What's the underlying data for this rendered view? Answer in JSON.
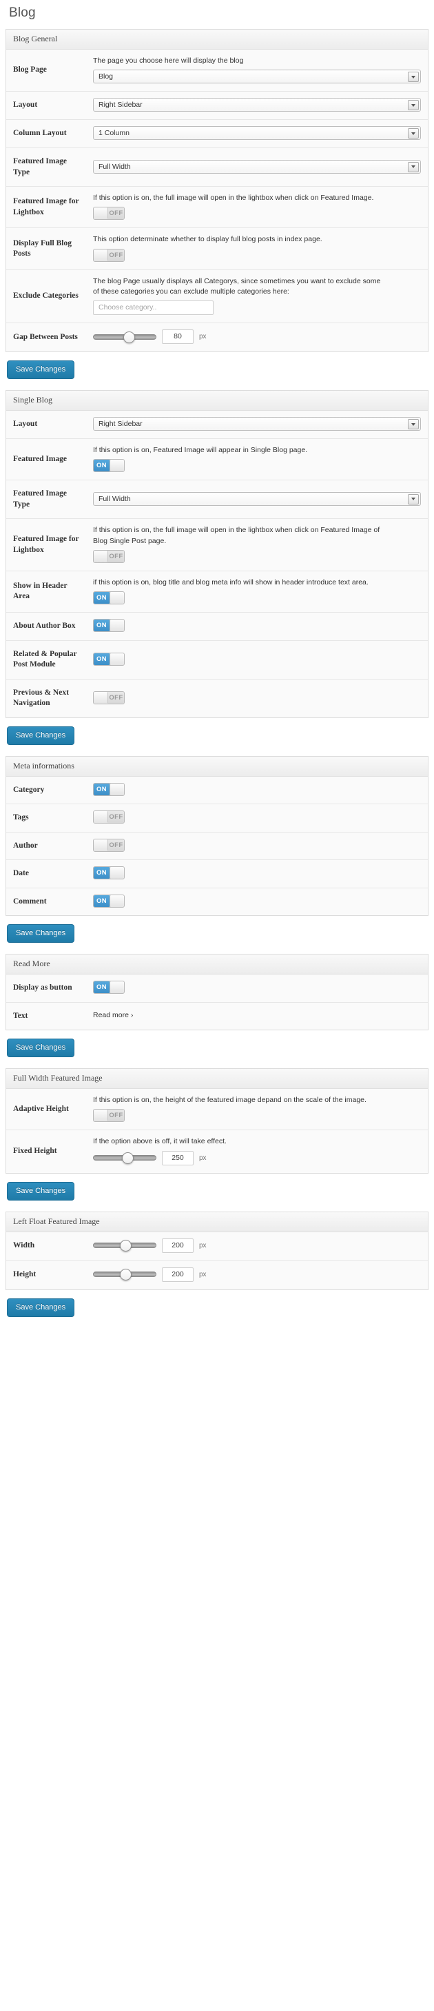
{
  "page": {
    "title": "Blog"
  },
  "save_label": "Save Changes",
  "units": {
    "px": "px"
  },
  "sections": [
    {
      "id": "blog-general",
      "header": "Blog General",
      "rows": [
        {
          "label": "Blog Page",
          "desc": "The page you choose here will display the blog",
          "control": "select",
          "value": "Blog",
          "width": "wide"
        },
        {
          "label": "Layout",
          "desc": "",
          "control": "select",
          "value": "Right Sidebar",
          "width": "narrow"
        },
        {
          "label": "Column Layout",
          "desc": "",
          "control": "select",
          "value": "1 Column",
          "width": "narrow"
        },
        {
          "label": "Featured Image Type",
          "desc": "",
          "control": "select",
          "value": "Full Width",
          "width": "narrow"
        },
        {
          "label": "Featured Image for Lightbox",
          "desc": "If this option is on, the full image will open in the lightbox when click on Featured Image.",
          "control": "toggle",
          "value": "OFF"
        },
        {
          "label": "Display Full Blog Posts",
          "desc": "This option determinate whether to display full blog posts in index page.",
          "control": "toggle",
          "value": "OFF"
        },
        {
          "label": "Exclude Categories",
          "desc": "The blog Page usually displays all Categorys, since sometimes you want to exclude some of these categories you can exclude multiple categories here:",
          "control": "text",
          "value": "",
          "placeholder": "Choose category.."
        },
        {
          "label": "Gap Between Posts",
          "desc": "",
          "control": "slider",
          "value": "80",
          "unit": "px",
          "percent": 48
        }
      ]
    },
    {
      "id": "single-blog",
      "header": "Single Blog",
      "rows": [
        {
          "label": "Layout",
          "desc": "",
          "control": "select",
          "value": "Right Sidebar",
          "width": "narrow"
        },
        {
          "label": "Featured Image",
          "desc": "If this option is on, Featured Image will appear in Single Blog page.",
          "control": "toggle",
          "value": "ON"
        },
        {
          "label": "Featured Image Type",
          "desc": "",
          "control": "select",
          "value": "Full Width",
          "width": "narrow"
        },
        {
          "label": "Featured Image for Lightbox",
          "desc": "If this option is on, the full image will open in the lightbox when click on Featured Image of Blog Single Post page.",
          "control": "toggle",
          "value": "OFF"
        },
        {
          "label": "Show in Header Area",
          "desc": "if this option is on, blog title and blog meta info will show in header introduce text area.",
          "control": "toggle",
          "value": "ON"
        },
        {
          "label": "About Author Box",
          "desc": "",
          "control": "toggle",
          "value": "ON"
        },
        {
          "label": "Related & Popular Post Module",
          "desc": "",
          "control": "toggle",
          "value": "ON"
        },
        {
          "label": "Previous & Next Navigation",
          "desc": "",
          "control": "toggle",
          "value": "OFF"
        }
      ]
    },
    {
      "id": "meta-informations",
      "header": "Meta informations",
      "rows": [
        {
          "label": "Category",
          "desc": "",
          "control": "toggle",
          "value": "ON"
        },
        {
          "label": "Tags",
          "desc": "",
          "control": "toggle",
          "value": "OFF"
        },
        {
          "label": "Author",
          "desc": "",
          "control": "toggle",
          "value": "OFF"
        },
        {
          "label": "Date",
          "desc": "",
          "control": "toggle",
          "value": "ON"
        },
        {
          "label": "Comment",
          "desc": "",
          "control": "toggle",
          "value": "ON"
        }
      ]
    },
    {
      "id": "read-more",
      "header": "Read More",
      "rows": [
        {
          "label": "Display as button",
          "desc": "",
          "control": "toggle",
          "value": "ON"
        },
        {
          "label": "Text",
          "desc": "",
          "control": "static",
          "value": "Read more ›"
        }
      ]
    },
    {
      "id": "full-width-featured-image",
      "header": "Full Width Featured Image",
      "rows": [
        {
          "label": "Adaptive Height",
          "desc": "If this option is on, the height of the featured image depand on the scale of the image.",
          "control": "toggle",
          "value": "OFF"
        },
        {
          "label": "Fixed Height",
          "desc": "If the option above is off, it will take effect.",
          "control": "slider",
          "value": "250",
          "unit": "px",
          "percent": 46
        }
      ]
    },
    {
      "id": "left-float-featured-image",
      "header": "Left Float Featured Image",
      "rows": [
        {
          "label": "Width",
          "desc": "",
          "control": "slider",
          "value": "200",
          "unit": "px",
          "percent": 42
        },
        {
          "label": "Height",
          "desc": "",
          "control": "slider",
          "value": "200",
          "unit": "px",
          "percent": 42
        }
      ]
    }
  ]
}
